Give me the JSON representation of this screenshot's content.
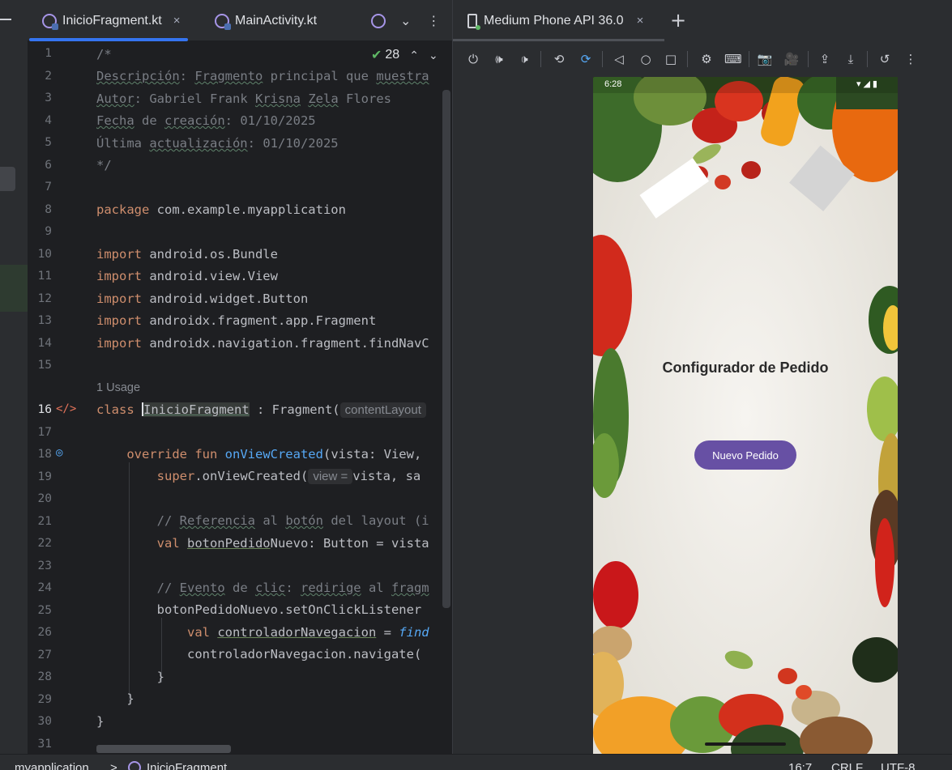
{
  "editor": {
    "tabs": [
      {
        "label": "InicioFragment.kt",
        "close": "×"
      },
      {
        "label": "MainActivity.kt"
      }
    ],
    "inspection_count": "28",
    "usage_hint": "1 Usage",
    "line_numbers": [
      "1",
      "2",
      "3",
      "4",
      "5",
      "6",
      "7",
      "8",
      "9",
      "10",
      "11",
      "12",
      "13",
      "14",
      "15",
      "16",
      "17",
      "18",
      "19",
      "20",
      "21",
      "22",
      "23",
      "24",
      "25",
      "26",
      "27",
      "28",
      "29",
      "30",
      "31"
    ],
    "code": {
      "l1": "/*",
      "l2_a": "Descripción",
      "l2_b": ": ",
      "l2_c": "Fragmento",
      "l2_d": " principal que ",
      "l2_e": "muestra",
      "l3_a": "Autor",
      "l3_b": ": Gabriel Frank ",
      "l3_c": "Krisna",
      "l3_d": " ",
      "l3_e": "Zela",
      "l3_f": " Flores",
      "l4_a": "Fecha",
      "l4_b": " de ",
      "l4_c": "creación",
      "l4_d": ": 01/10/2025",
      "l5_a": "Última ",
      "l5_b": "actualización",
      "l5_c": ": 01/10/2025",
      "l6": "*/",
      "l8_kw": "package",
      "l8_rest": " com.example.myapplication",
      "import_kw": "import",
      "l10": " android.os.Bundle",
      "l11": " android.view.View",
      "l12": " android.widget.Button",
      "l13": " androidx.fragment.app.Fragment",
      "l14": " androidx.navigation.fragment.findNavC",
      "l16_kw": "class ",
      "l16_name": "InicioFragment",
      "l16_rest": " : Fragment(",
      "l16_hint": "contentLayout",
      "l18_kw": "override fun ",
      "l18_fn": "onViewCreated",
      "l18_rest": "(vista: View,",
      "l19_kw": "super",
      "l19_a": ".onViewCreated(",
      "l19_hint": "view =",
      "l19_b": "vista, sa",
      "l21_a": "// ",
      "l21_b": "Referencia",
      "l21_c": " al ",
      "l21_d": "botón",
      "l21_e": " del layout (i",
      "l22_kw": "val ",
      "l22_var": "botonPedido",
      "l22_rest": "Nuevo: Button = vista",
      "l24_a": "// ",
      "l24_b": "Evento",
      "l24_c": " de ",
      "l24_d": "clic",
      "l24_e": ": ",
      "l24_f": "redirige",
      "l24_g": " al ",
      "l24_h": "fragm",
      "l25": "botonPedidoNuevo.setOnClickListener",
      "l26_kw": "val ",
      "l26_var": "controladorNavegacion",
      "l26_eq": " = ",
      "l26_it": "find",
      "l27": "controladorNavegacion.navigate(",
      "l28": "}",
      "l29": "}",
      "l30": "}"
    }
  },
  "device": {
    "tab_label": "Medium Phone API 36.0",
    "tab_close": "×",
    "add": "+",
    "phone": {
      "time": "6:28",
      "title": "Configurador de Pedido",
      "button": "Nuevo Pedido"
    }
  },
  "statusbar": {
    "project": "myapplication",
    "separator": ">",
    "file": "InicioFragment",
    "position": "16:7",
    "line_ending": "CRLF",
    "encoding": "UTF-8"
  }
}
